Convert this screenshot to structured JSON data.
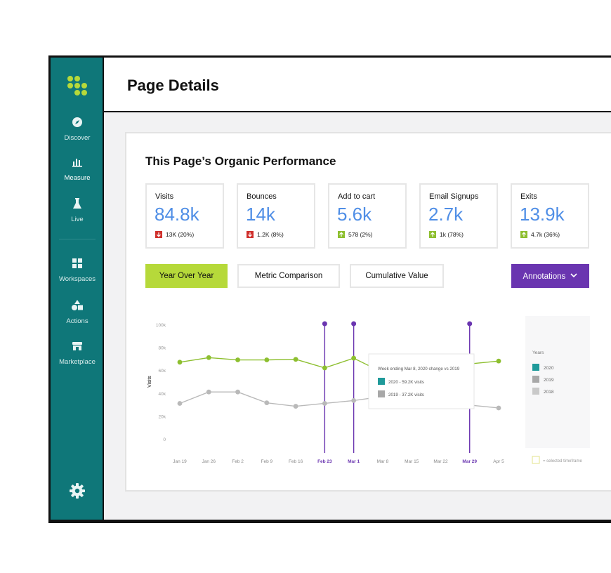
{
  "sidebar": {
    "items": [
      {
        "label": "Discover",
        "icon": "compass-icon"
      },
      {
        "label": "Measure",
        "icon": "bar-chart-icon"
      },
      {
        "label": "Live",
        "icon": "flask-icon"
      },
      {
        "label": "Workspaces",
        "icon": "grid-icon"
      },
      {
        "label": "Actions",
        "icon": "shapes-icon"
      },
      {
        "label": "Marketplace",
        "icon": "store-icon"
      }
    ],
    "settings_icon": "gear-icon"
  },
  "header": {
    "title": "Page Details"
  },
  "card": {
    "title": "This Page’s Organic Performance",
    "metrics": [
      {
        "label": "Visits",
        "value": "84.8k",
        "delta": "13K (20%)",
        "trend": "down"
      },
      {
        "label": "Bounces",
        "value": "14k",
        "delta": "1.2K (8%)",
        "trend": "down"
      },
      {
        "label": "Add to cart",
        "value": "5.6k",
        "delta": "578 (2%)",
        "trend": "up"
      },
      {
        "label": "Email Signups",
        "value": "2.7k",
        "delta": "1k (78%)",
        "trend": "up"
      },
      {
        "label": "Exits",
        "value": "13.9k",
        "delta": "4.7k (36%)",
        "trend": "up"
      }
    ],
    "tabs": [
      {
        "label": "Year Over Year",
        "active": true
      },
      {
        "label": "Metric Comparison",
        "active": false
      },
      {
        "label": "Cumulative Value",
        "active": false
      }
    ],
    "annotations_label": "Annotations"
  },
  "colors": {
    "teal": "#0f7779",
    "lime": "#b6d93a",
    "purple": "#6a35b0",
    "blue": "#4f8ee6",
    "down": "#d0312d",
    "up": "#8dbf2f"
  },
  "chart_data": {
    "type": "line",
    "ylabel": "Visits",
    "ylim": [
      0,
      100000
    ],
    "yticks": [
      "100k",
      "80k",
      "60k",
      "40k",
      "20k",
      "0"
    ],
    "categories": [
      "Jan 19",
      "Jan 26",
      "Feb 2",
      "Feb 9",
      "Feb 16",
      "Feb 23",
      "Mar 1",
      "Mar 8",
      "Mar 15",
      "Mar 22",
      "Mar 29",
      "Apr 5"
    ],
    "highlighted_categories": [
      "Feb 23",
      "Mar 1",
      "Mar 29"
    ],
    "series": [
      {
        "name": "2020",
        "color": "#8dbf2f",
        "values": [
          67000,
          71000,
          69000,
          69000,
          69500,
          62000,
          70500,
          58000,
          null,
          null,
          null,
          68000
        ]
      },
      {
        "name": "2019",
        "color": "#b9b9b9",
        "values": [
          31000,
          41000,
          41000,
          31500,
          28500,
          31000,
          33500,
          37000,
          null,
          null,
          null,
          27000
        ]
      }
    ],
    "tooltip": {
      "title": "Week ending Mar 8, 2020 change vs 2019",
      "lines": [
        "2020 - 59.2K visits",
        "2019 - 37.2K visits"
      ]
    },
    "legend": {
      "title": "Years",
      "items": [
        {
          "label": "2020",
          "color": "#1f9a9a"
        },
        {
          "label": "2019",
          "color": "#a8a8a8"
        },
        {
          "label": "2018",
          "color": "#c9c9c9"
        }
      ],
      "note": "= selected timeframe",
      "placement": "right"
    }
  }
}
